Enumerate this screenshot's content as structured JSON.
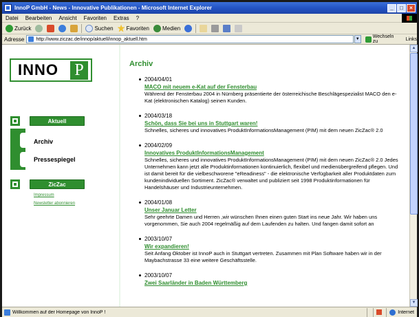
{
  "window": {
    "title": "InnoP GmbH - News - Innovative Publikationen - Microsoft Internet Explorer",
    "minimize": "_",
    "maximize": "□",
    "close": "×"
  },
  "menu": {
    "items": [
      "Datei",
      "Bearbeiten",
      "Ansicht",
      "Favoriten",
      "Extras",
      "?"
    ]
  },
  "toolbar": {
    "back_label": "Zurück",
    "search_label": "Suchen",
    "favorites_label": "Favoriten",
    "media_label": "Medien"
  },
  "address": {
    "label": "Adresse",
    "url": "http://www.ziczac.de/innop/aktuell/innop_aktuell.htm",
    "go_label": "Wechseln zu",
    "links_label": "Links"
  },
  "sidebar": {
    "logo_text": "INNO",
    "logo_p": "P",
    "aktuell": "Aktuell",
    "archiv": "Archiv",
    "pressespiegel": "Pressespiegel",
    "ziczac": "ZicZac",
    "impressum": "Impressum",
    "newsletter": "Newsletter abonnieren"
  },
  "content": {
    "heading": "Archiv",
    "entries": [
      {
        "date": "2004/04/01",
        "title": "MACO mit neuem e-Kat auf der Fensterbau",
        "desc": "Während der Fensterbau 2004 in Nürnberg präsentierte der österreichische Beschlägespezialist MACO den e-Kat (elektronischen Katalog) seinen Kunden."
      },
      {
        "date": "2004/03/18",
        "title": "Schön, dass Sie bei uns in Stuttgart waren!",
        "desc": "Schnelles, sicheres und innovatives ProduktInformationsManagement (PIM) mit dem neuen ZicZac® 2.0"
      },
      {
        "date": "2004/02/09",
        "title": "Innovatives ProduktInformationsManagement",
        "desc": "Schnelles, sicheres und innovatives ProduktInformationsManagement (PIM) mit dem neuen ZicZac® 2.0 Jedes Unternehmen kann jetzt alle Produktinformationen kontinuierlich, flexibel und medienübergreifend pflegen. Und ist damit bereit für die vielbeschworene \"eReadiness\" - die elektronische Verfügbarkeit aller Produktdaten zum kundenindividuellen Sortiment. ZicZac® verwaltet und publiziert seit 1998 Produktinformationen für Handelshäuser und Industrieunternehmen."
      },
      {
        "date": "2004/01/08",
        "title": "Unser Januar Letter",
        "desc": "Sehr geehrte Damen und Herren ,wir wünschen Ihnen einen guten Start ins neue Jahr. Wir haben uns vorgenommen, Sie auch 2004 regelmäßig auf dem Laufenden zu halten. Und fangen damit sofort an"
      },
      {
        "date": "2003/10/07",
        "title": "Wir expandieren!",
        "desc": "Seit Anfang Oktober ist InnoP auch in Stuttgart vertreten. Zusammen mit Plan Software haben wir in der Maybachstrasse 33 eine weitere Geschäftsstelle."
      },
      {
        "date": "2003/10/07",
        "title": "Zwei Saarländer in Baden Württemberg",
        "desc": ""
      }
    ]
  },
  "status": {
    "text": "Willkommen auf der Homepage von InnoP !",
    "zone": "Internet"
  }
}
